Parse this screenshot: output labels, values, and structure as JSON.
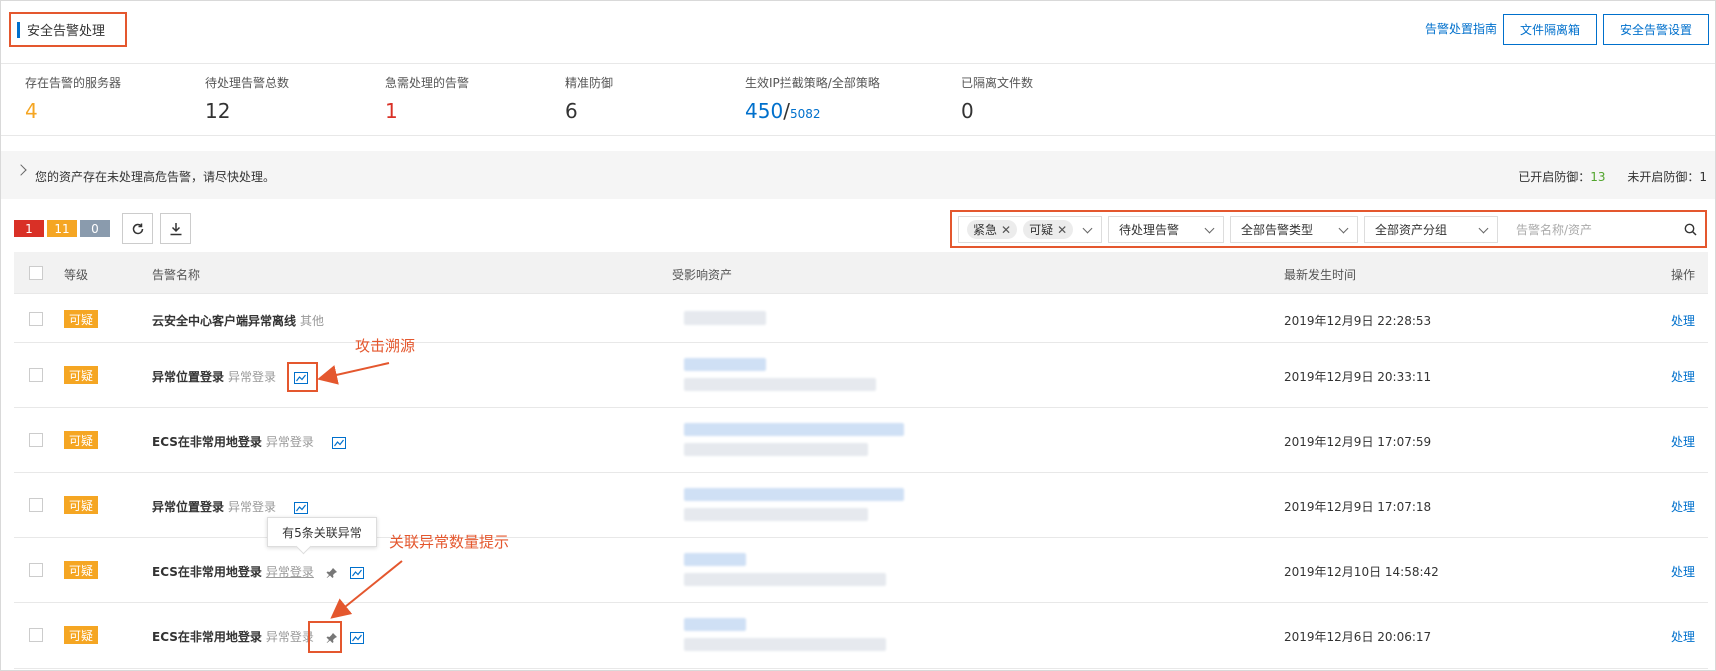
{
  "header": {
    "title": "安全告警处理",
    "guide_link": "告警处置指南",
    "quarantine_button": "文件隔离箱",
    "settings_button": "安全告警设置"
  },
  "stats": [
    {
      "label": "存在告警的服务器",
      "value": "4"
    },
    {
      "label": "待处理告警总数",
      "value": "12"
    },
    {
      "label": "急需处理的告警",
      "value": "1"
    },
    {
      "label": "精准防御",
      "value": "6"
    },
    {
      "label": "生效IP拦截策略/全部策略",
      "value": "450",
      "value_total": "5082"
    },
    {
      "label": "已隔离文件数",
      "value": "0"
    }
  ],
  "notice": {
    "text": "您的资产存在未处理高危告警，请尽快处理。",
    "defense_on_label": "已开启防御：",
    "defense_on_value": "13",
    "defense_off_label": "未开启防御：",
    "defense_off_value": "1"
  },
  "counts": {
    "urgent": "1",
    "suspicious": "11",
    "reminder": "0"
  },
  "filters": {
    "level_tags": [
      "紧急",
      "可疑"
    ],
    "status": "待处理告警",
    "type": "全部告警类型",
    "asset_group": "全部资产分组",
    "search_placeholder": "告警名称/资产"
  },
  "table": {
    "columns": [
      "等级",
      "告警名称",
      "受影响资产",
      "最新发生时间",
      "操作"
    ],
    "rows": [
      {
        "level": "可疑",
        "name": "云安全中心客户端异常离线",
        "type": "其他",
        "time": "2019年12月9日 22:28:53",
        "action": "处理"
      },
      {
        "level": "可疑",
        "name": "异常位置登录",
        "type": "异常登录",
        "time": "2019年12月9日 20:33:11",
        "action": "处理"
      },
      {
        "level": "可疑",
        "name": "ECS在非常用地登录",
        "type": "异常登录",
        "time": "2019年12月9日 17:07:59",
        "action": "处理"
      },
      {
        "level": "可疑",
        "name": "异常位置登录",
        "type": "异常登录",
        "time": "2019年12月9日 17:07:18",
        "action": "处理"
      },
      {
        "level": "可疑",
        "name": "ECS在非常用地登录",
        "type": "异常登录",
        "time": "2019年12月10日 14:58:42",
        "action": "处理"
      },
      {
        "level": "可疑",
        "name": "ECS在非常用地登录",
        "type": "异常登录",
        "time": "2019年12月6日 20:06:17",
        "action": "处理"
      }
    ]
  },
  "annotations": {
    "trace": "攻击溯源",
    "related": "关联异常数量提示",
    "tooltip": "有5条关联异常"
  },
  "colors": {
    "accent": "#0070cc",
    "urgent": "#d93026",
    "suspicious": "#f5a623",
    "highlight": "#e4572e"
  }
}
